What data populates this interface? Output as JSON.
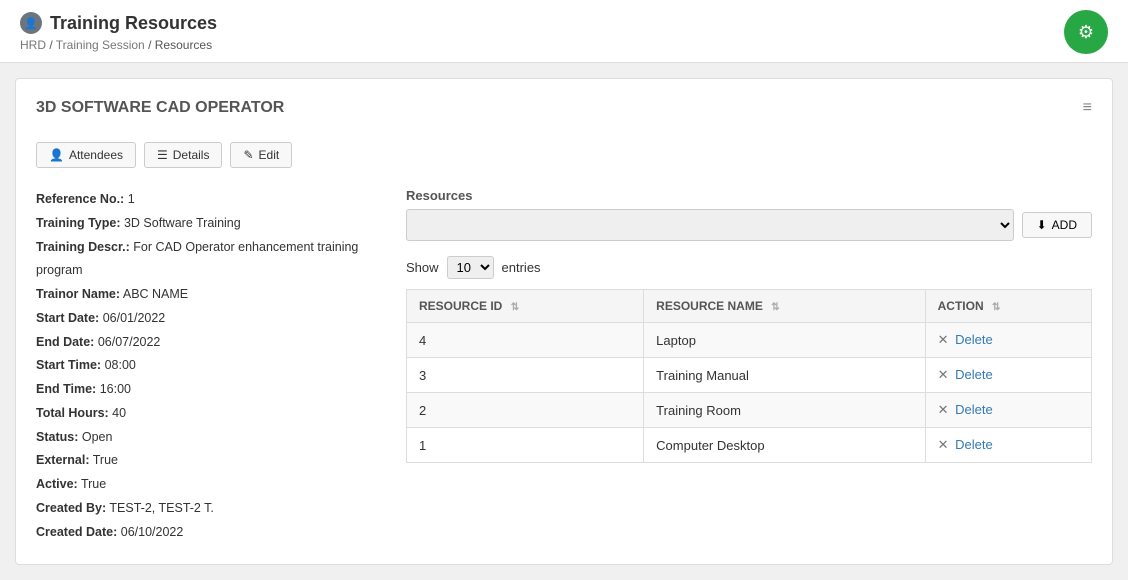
{
  "header": {
    "icon": "👤",
    "title": "Training Resources",
    "breadcrumb": [
      "HRD",
      "Training Session",
      "Resources"
    ],
    "gear_label": "⚙"
  },
  "section": {
    "title": "3D SOFTWARE CAD OPERATOR",
    "menu_icon": "≡"
  },
  "toolbar": {
    "attendees_label": "Attendees",
    "details_label": "Details",
    "edit_label": "Edit"
  },
  "info": {
    "reference_no_label": "Reference No.:",
    "reference_no_value": "1",
    "training_type_label": "Training Type:",
    "training_type_value": "3D Software Training",
    "training_descr_label": "Training Descr.:",
    "training_descr_value": "For CAD Operator enhancement training program",
    "trainor_name_label": "Trainor Name:",
    "trainor_name_value": "ABC NAME",
    "start_date_label": "Start Date:",
    "start_date_value": "06/01/2022",
    "end_date_label": "End Date:",
    "end_date_value": "06/07/2022",
    "start_time_label": "Start Time:",
    "start_time_value": "08:00",
    "end_time_label": "End Time:",
    "end_time_value": "16:00",
    "total_hours_label": "Total Hours:",
    "total_hours_value": "40",
    "status_label": "Status:",
    "status_value": "Open",
    "external_label": "External:",
    "external_value": "True",
    "active_label": "Active:",
    "active_value": "True",
    "created_by_label": "Created By:",
    "created_by_value": "TEST-2, TEST-2 T.",
    "created_date_label": "Created Date:",
    "created_date_value": "06/10/2022"
  },
  "resources_panel": {
    "label": "Resources",
    "select_placeholder": "",
    "add_label": "ADD",
    "show_label": "Show",
    "entries_label": "entries",
    "show_value": "10"
  },
  "table": {
    "columns": [
      {
        "label": "RESOURCE ID"
      },
      {
        "label": "RESOURCE NAME"
      },
      {
        "label": "ACTION"
      }
    ],
    "rows": [
      {
        "id": "4",
        "name": "Laptop",
        "action": "Delete"
      },
      {
        "id": "3",
        "name": "Training Manual",
        "action": "Delete"
      },
      {
        "id": "2",
        "name": "Training Room",
        "action": "Delete"
      },
      {
        "id": "1",
        "name": "Computer Desktop",
        "action": "Delete"
      }
    ]
  }
}
